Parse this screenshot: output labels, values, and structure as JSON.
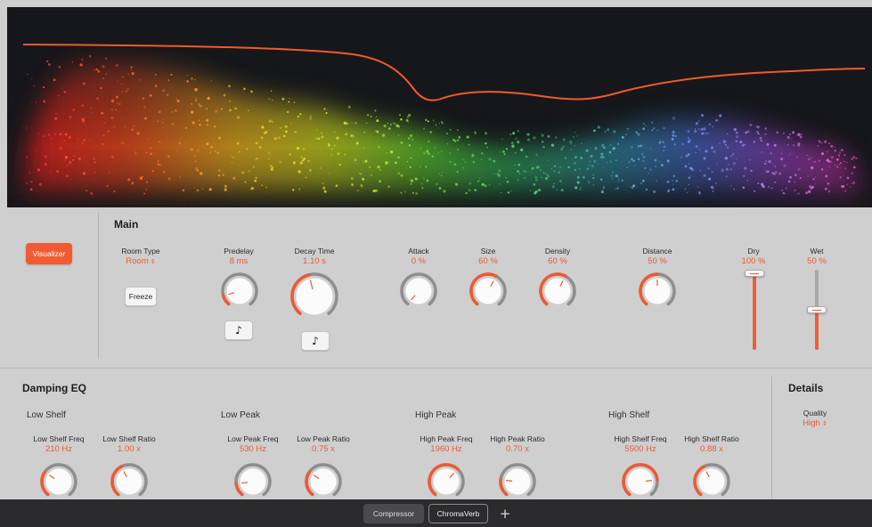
{
  "visualizer": {
    "label": "Visualizer"
  },
  "main": {
    "title": "Main",
    "room_type": {
      "label": "Room Type",
      "value": "Room"
    },
    "freeze": {
      "label": "Freeze"
    },
    "predelay": {
      "label": "Predelay",
      "value": "8 ms",
      "level": 0.12
    },
    "decay_time": {
      "label": "Decay Time",
      "value": "1.10 s",
      "level": 0.45
    },
    "attack": {
      "label": "Attack",
      "value": "0 %",
      "level": 0.0
    },
    "size": {
      "label": "Size",
      "value": "60 %",
      "level": 0.6
    },
    "density": {
      "label": "Density",
      "value": "60 %",
      "level": 0.6
    },
    "distance": {
      "label": "Distance",
      "value": "50 %",
      "level": 0.5
    },
    "dry": {
      "label": "Dry",
      "value": "100 %",
      "level": 1.0
    },
    "wet": {
      "label": "Wet",
      "value": "50 %",
      "level": 0.5
    },
    "sync_icon": "music-note-icon"
  },
  "damping_eq": {
    "title": "Damping EQ",
    "low_shelf": {
      "title": "Low Shelf",
      "freq": {
        "label": "Low Shelf Freq",
        "value": "210 Hz",
        "level": 0.3
      },
      "ratio": {
        "label": "Low Shelf Ratio",
        "value": "1.00 x",
        "level": 0.4
      }
    },
    "low_peak": {
      "title": "Low Peak",
      "freq": {
        "label": "Low Peak Freq",
        "value": "530 Hz",
        "level": 0.15
      },
      "ratio": {
        "label": "Low Peak Ratio",
        "value": "0.75 x",
        "level": 0.3
      }
    },
    "high_peak": {
      "title": "High Peak",
      "freq": {
        "label": "High Peak Freq",
        "value": "1960 Hz",
        "level": 0.65
      },
      "ratio": {
        "label": "High Peak Ratio",
        "value": "0.70 x",
        "level": 0.2
      }
    },
    "high_shelf": {
      "title": "High Shelf",
      "freq": {
        "label": "High Shelf Freq",
        "value": "5500 Hz",
        "level": 0.8
      },
      "ratio": {
        "label": "High Shelf Ratio",
        "value": "0.88 x",
        "level": 0.4
      }
    }
  },
  "details": {
    "title": "Details",
    "quality": {
      "label": "Quality",
      "value": "High"
    }
  },
  "bottom_bar": {
    "tabs": [
      {
        "label": "Compressor",
        "active": false
      },
      {
        "label": "ChromaVerb",
        "active": true
      }
    ],
    "add_label": "+"
  },
  "colors": {
    "accent": "#ec5a35",
    "panel": "#cfcfcf",
    "visualizer_bg": "#16171b",
    "curve": "#f05a2c"
  }
}
